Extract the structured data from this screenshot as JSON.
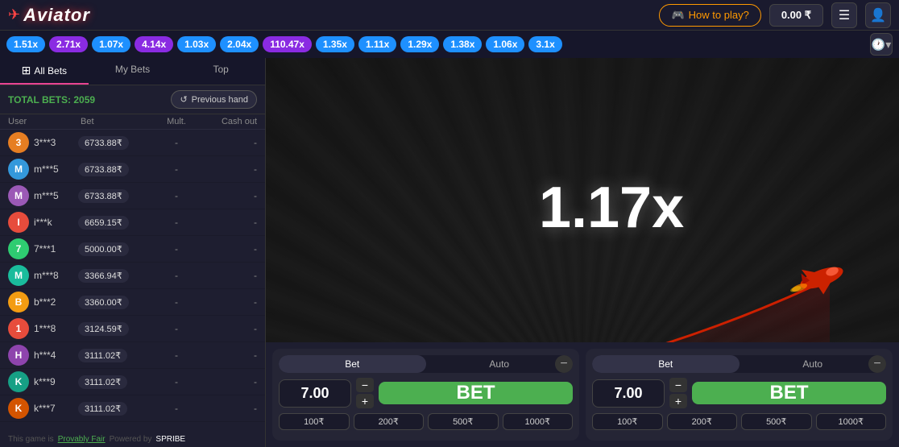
{
  "header": {
    "logo": "Aviator",
    "how_to_play": "How to play?",
    "balance": "0.00 ₹",
    "menu_icon": "☰",
    "user_icon": "👤"
  },
  "multiplier_bar": {
    "items": [
      {
        "value": "1.51x",
        "color": "blue"
      },
      {
        "value": "2.71x",
        "color": "purple"
      },
      {
        "value": "1.07x",
        "color": "blue"
      },
      {
        "value": "4.14x",
        "color": "purple"
      },
      {
        "value": "1.03x",
        "color": "blue"
      },
      {
        "value": "2.04x",
        "color": "blue"
      },
      {
        "value": "110.47x",
        "color": "purple"
      },
      {
        "value": "1.35x",
        "color": "blue"
      },
      {
        "value": "1.11x",
        "color": "blue"
      },
      {
        "value": "1.29x",
        "color": "blue"
      },
      {
        "value": "1.38x",
        "color": "blue"
      },
      {
        "value": "1.06x",
        "color": "blue"
      },
      {
        "value": "3.1x",
        "color": "blue"
      }
    ]
  },
  "tabs": {
    "all": "All Bets",
    "my_bets": "My Bets",
    "top": "Top"
  },
  "bets_section": {
    "total_label": "TOTAL BETS:",
    "total_count": "2059",
    "prev_hand": "Previous hand",
    "columns": {
      "user": "User",
      "bet": "Bet",
      "mult": "Mult.",
      "cash_out": "Cash out"
    }
  },
  "bets": [
    {
      "username": "3***3",
      "amount": "6733.88₹",
      "mult": "-",
      "cash": "-",
      "avatar_color": "#e67e22",
      "avatar_text": "3"
    },
    {
      "username": "m***5",
      "amount": "6733.88₹",
      "mult": "-",
      "cash": "-",
      "avatar_color": "#3498db",
      "avatar_text": "m"
    },
    {
      "username": "m***5",
      "amount": "6733.88₹",
      "mult": "-",
      "cash": "-",
      "avatar_color": "#9b59b6",
      "avatar_text": "m"
    },
    {
      "username": "i***k",
      "amount": "6659.15₹",
      "mult": "-",
      "cash": "-",
      "avatar_color": "#e74c3c",
      "avatar_text": "i"
    },
    {
      "username": "7***1",
      "amount": "5000.00₹",
      "mult": "-",
      "cash": "-",
      "avatar_color": "#2ecc71",
      "avatar_text": "7"
    },
    {
      "username": "m***8",
      "amount": "3366.94₹",
      "mult": "-",
      "cash": "-",
      "avatar_color": "#1abc9c",
      "avatar_text": "m"
    },
    {
      "username": "b***2",
      "amount": "3360.00₹",
      "mult": "-",
      "cash": "-",
      "avatar_color": "#f39c12",
      "avatar_text": "b"
    },
    {
      "username": "1***8",
      "amount": "3124.59₹",
      "mult": "-",
      "cash": "-",
      "avatar_color": "#e74c3c",
      "avatar_text": "1"
    },
    {
      "username": "h***4",
      "amount": "3111.02₹",
      "mult": "-",
      "cash": "-",
      "avatar_color": "#8e44ad",
      "avatar_text": "h"
    },
    {
      "username": "k***9",
      "amount": "3111.02₹",
      "mult": "-",
      "cash": "-",
      "avatar_color": "#16a085",
      "avatar_text": "k"
    },
    {
      "username": "k***7",
      "amount": "3111.02₹",
      "mult": "-",
      "cash": "-",
      "avatar_color": "#d35400",
      "avatar_text": "k"
    }
  ],
  "game": {
    "multiplier": "1.17x"
  },
  "bet_panels": [
    {
      "tab_bet": "Bet",
      "tab_auto": "Auto",
      "amount": "7.00",
      "bet_label": "BET",
      "quick": [
        "100₹",
        "200₹",
        "500₹",
        "1000₹"
      ]
    },
    {
      "tab_bet": "Bet",
      "tab_auto": "Auto",
      "amount": "7.00",
      "bet_label": "BET",
      "quick": [
        "100₹",
        "200₹",
        "500₹",
        "1000₹"
      ]
    }
  ],
  "footer": {
    "provably_fair": "This game is",
    "fair_label": "Provably Fair",
    "powered": "Powered by",
    "engine": "SPRIBE"
  }
}
